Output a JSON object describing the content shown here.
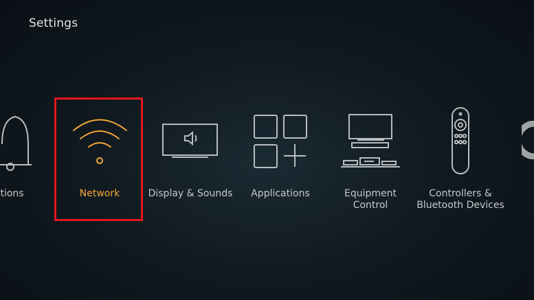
{
  "header": {
    "title": "Settings"
  },
  "menu": {
    "items": [
      {
        "label": "fications",
        "icon": "bell-icon"
      },
      {
        "label": "Network",
        "icon": "wifi-icon",
        "selected": true
      },
      {
        "label": "Display & Sounds",
        "icon": "tv-speaker-icon"
      },
      {
        "label": "Applications",
        "icon": "apps-grid-icon"
      },
      {
        "label": "Equipment\nControl",
        "icon": "equipment-icon"
      },
      {
        "label": "Controllers &\nBluetooth Devices",
        "icon": "remote-icon"
      }
    ]
  },
  "colors": {
    "accent": "#f3a634",
    "focus": "#e3171d",
    "icon_stroke": "#b9bdc0",
    "background": "#111a21"
  }
}
